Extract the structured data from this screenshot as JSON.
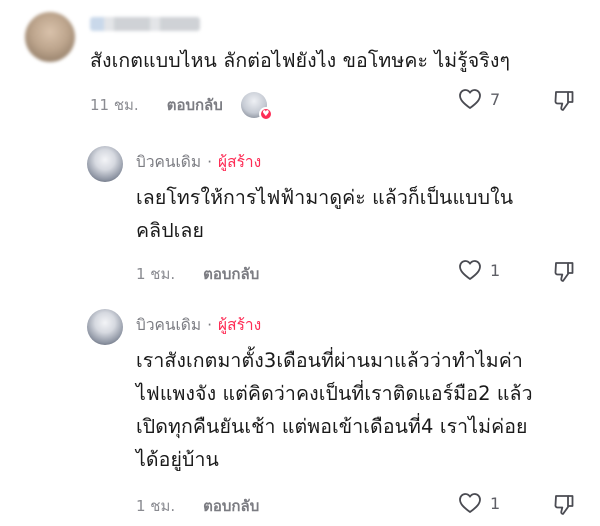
{
  "comments": [
    {
      "author": "",
      "text": "สังเกตแบบไหน ลักต่อไฟยังไง ขอโทษคะ ไม่รู้จริงๆ",
      "time": "11 ชม.",
      "reply_label": "ตอบกลับ",
      "like_count": "7"
    },
    {
      "author": "บิวคนเดิม",
      "separator": "·",
      "creator_label": "ผู้สร้าง",
      "text_lines": [
        "เลยโทรให้การไฟฟ้ามาดูค่ะ แล้วก็เป็นแบบใน",
        "คลิปเลย"
      ],
      "time": "1 ชม.",
      "reply_label": "ตอบกลับ",
      "like_count": "1"
    },
    {
      "author": "บิวคนเดิม",
      "separator": "·",
      "creator_label": "ผู้สร้าง",
      "text_lines": [
        "เราสังเกตมาตั้ง3เดือนที่ผ่านมาแล้วว่าทำไมค่า",
        "ไฟแพงจัง แต่คิดว่าคงเป็นที่เราติดแอร์มือ2 แล้ว",
        "เปิดทุกคืนยันเช้า แต่พอเข้าเดือนที่4 เราไม่ค่อย",
        "ได้อยู่บ้าน"
      ],
      "time": "1 ชม.",
      "reply_label": "ตอบกลับ",
      "like_count": "1"
    }
  ],
  "colors": {
    "creator": "#fe2c55",
    "meta": "#8a8b91",
    "text": "#1a1a1a"
  }
}
